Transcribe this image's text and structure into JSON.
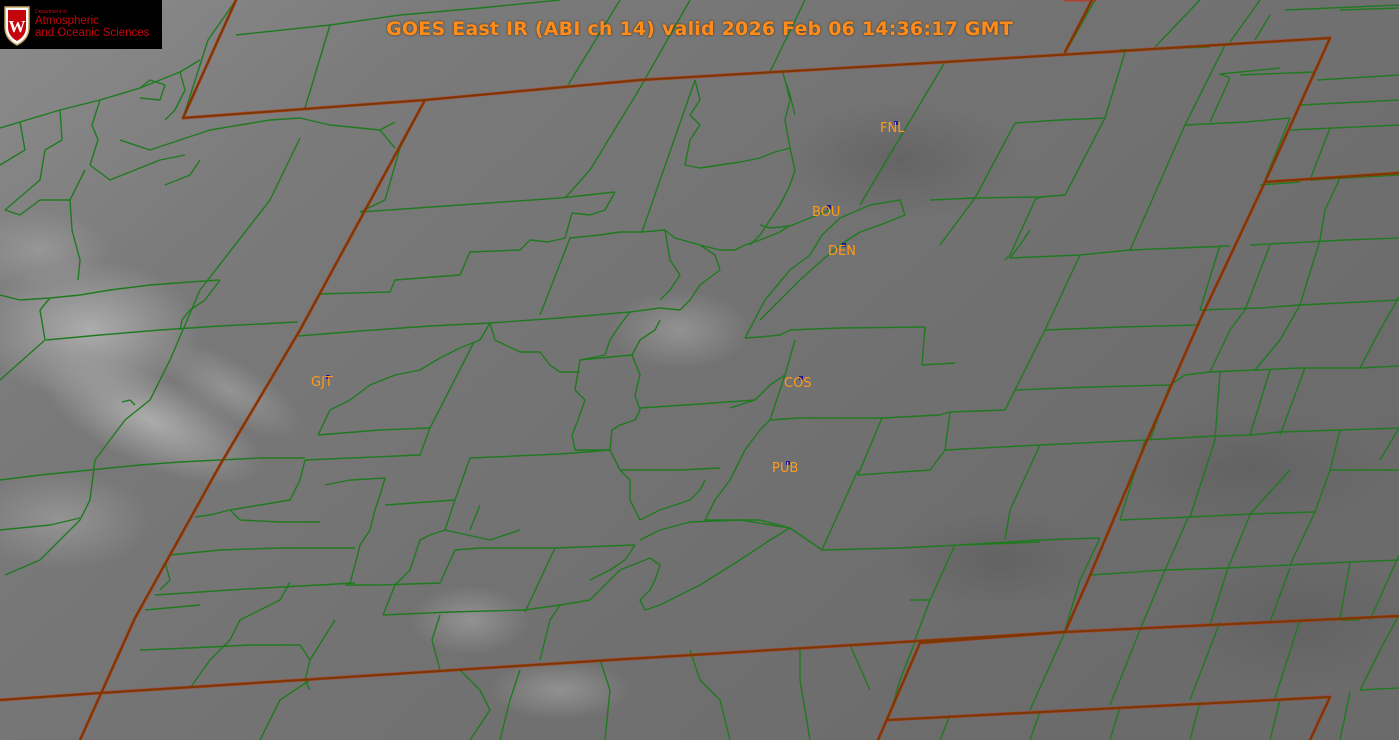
{
  "title": "GOES East IR (ABI ch 14) valid 2026 Feb 06 14:36:17 GMT",
  "logo": {
    "small_text": "Department of",
    "line1": "Atmospheric",
    "line2": "and Oceanic Sciences",
    "crest_letter": "W",
    "crest_color": "#c5050c"
  },
  "colors": {
    "state_border": "#8a3a00",
    "state_border_glow": "#d02000",
    "county_border": "#1f7a1f",
    "label": "#ff9a1a",
    "station_marker": "#1a1aa0",
    "title": "#ff8c1a"
  },
  "stations": [
    "FNL",
    "BOU",
    "DEN",
    "GJT",
    "COS",
    "PUB"
  ]
}
